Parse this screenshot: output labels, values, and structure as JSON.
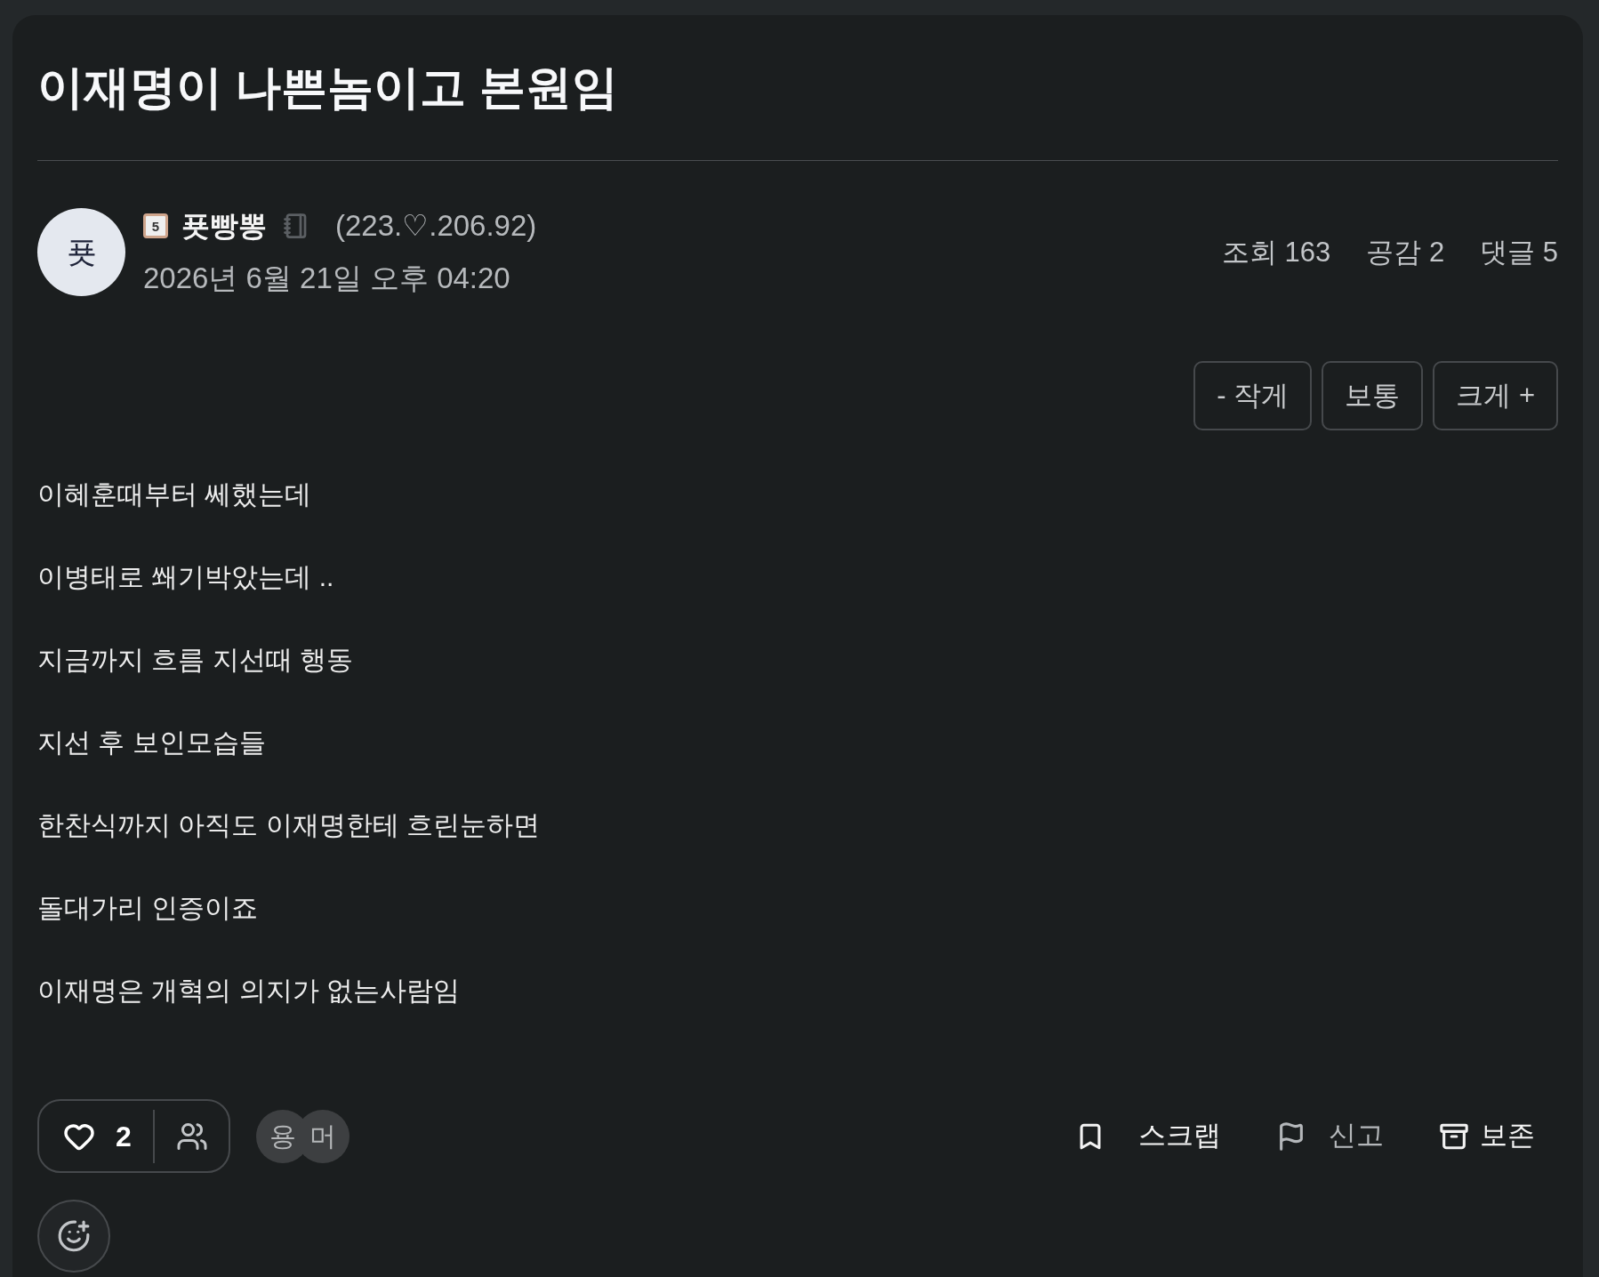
{
  "post": {
    "title": "이재명이 나쁜놈이고 본원임"
  },
  "author": {
    "avatar": "푯",
    "level": "5",
    "name": "푯빵뽕",
    "ip": "(223.♡.206.92)",
    "date": "2026년 6월 21일 오후 04:20"
  },
  "stats": [
    "조회 163",
    "공감 2",
    "댓글 5"
  ],
  "font_size_buttons": [
    "- 작게",
    "보통",
    "크게 +"
  ],
  "body": [
    "이혜훈때부터 쎄했는데",
    "이병태로 쐐기박았는데 ..",
    "지금까지 흐름 지선때 행동",
    "지선 후 보인모습들",
    "한찬식까지 아직도 이재명한테 흐린눈하면",
    "돌대가리 인증이죠",
    "이재명은 개혁의 의지가 없는사람임"
  ],
  "reactions": {
    "count": "2",
    "reactors": [
      "용",
      "머"
    ]
  },
  "actions": [
    {
      "kind": "scrap",
      "label": "스크랩"
    },
    {
      "kind": "report",
      "label": "신고"
    },
    {
      "kind": "archive",
      "label": "보존"
    }
  ]
}
